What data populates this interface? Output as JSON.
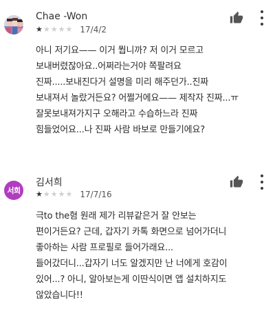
{
  "reviews": [
    {
      "author": "Chae -Won",
      "rating": 1,
      "rating_max": 5,
      "date": "17/4/2",
      "lines": [
        "아니 저기요—— 이거 뭡니까? 저 이거 모르고",
        "보내버렸잖아요..어쩌라는거야 쪽팔려요",
        "진짜.....보내진다거 설명을 미리 해주던가..진짜",
        "보내져서 놀랐거든요? 어쩔거에요—— 제작자 진짜...ㅠ",
        "잘못보내져가지구 오해라고 수습하느라 진짜",
        "힘들었어요...나 진짜 사람 바보로 만들기에요?"
      ]
    },
    {
      "author": "김서희",
      "avatar_initials": "서희",
      "avatar_color": "#b13cc0",
      "rating": 1,
      "rating_max": 5,
      "date": "17/7/16",
      "lines": [
        "극to the혐 원래 제가 리뷰같은거 잘 안보는",
        "편이거든요? 근데, 갑자기 카톡 화면으로 넘어가더니",
        "좋아하는 사람 프로필로 들어가래요...",
        "들어갔더니...갑자기 너도 알겠지만 난 너에게 호감이",
        "있어...? 아니, 알아보는게 이딴식이면 앱 설치하지도",
        "않았습니다!!"
      ]
    }
  ],
  "icons": {
    "thumb": "thumbs-up-icon",
    "more": "more-vert-icon"
  }
}
